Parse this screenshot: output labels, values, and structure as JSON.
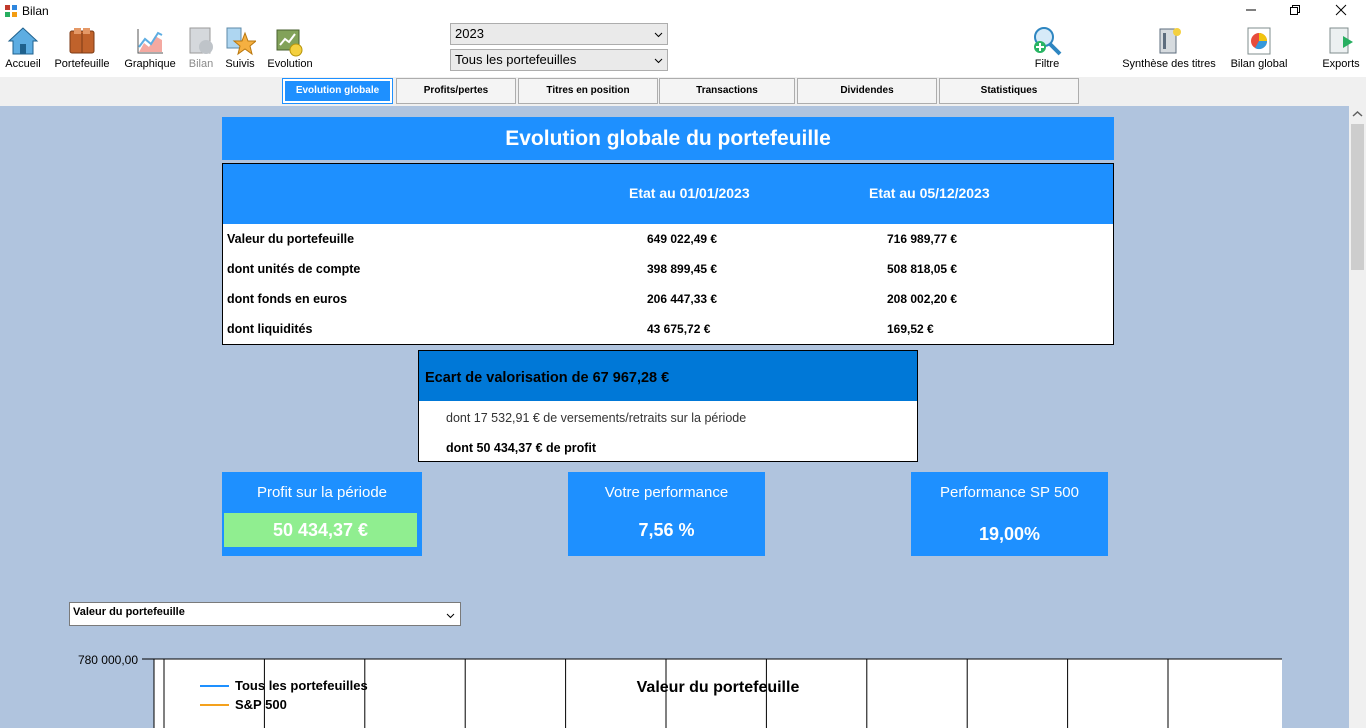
{
  "window": {
    "title": "Bilan"
  },
  "toolbar": {
    "items": [
      {
        "label": "Accueil",
        "icon": "home-icon"
      },
      {
        "label": "Portefeuille",
        "icon": "portfolio-icon"
      },
      {
        "label": "Graphique",
        "icon": "chart-icon"
      },
      {
        "label": "Bilan",
        "icon": "report-icon",
        "disabled": true
      },
      {
        "label": "Suivis",
        "icon": "star-icon"
      },
      {
        "label": "Evolution",
        "icon": "evolution-icon"
      },
      {
        "label": "Filtre",
        "icon": "search-filter-icon"
      },
      {
        "label": "Synthèse des titres",
        "icon": "summary-icon"
      },
      {
        "label": "Bilan global",
        "icon": "global-report-icon"
      },
      {
        "label": "Exports",
        "icon": "export-icon"
      }
    ],
    "year_select": "2023",
    "portfolio_select": "Tous les portefeuilles"
  },
  "tabs": [
    {
      "label": "Evolution globale",
      "active": true
    },
    {
      "label": "Profits/pertes"
    },
    {
      "label": "Titres en position"
    },
    {
      "label": "Transactions"
    },
    {
      "label": "Dividendes"
    },
    {
      "label": "Statistiques"
    }
  ],
  "evolution": {
    "title": "Evolution globale du portefeuille",
    "col1": "Etat au 01/01/2023",
    "col2": "Etat au 05/12/2023",
    "rows": [
      {
        "label": "Valeur du portefeuille",
        "v1": "649 022,49 €",
        "v2": "716 989,77 €"
      },
      {
        "label": "dont unités de compte",
        "v1": "398 899,45 €",
        "v2": "508 818,05 €"
      },
      {
        "label": "dont fonds en euros",
        "v1": "206 447,33 €",
        "v2": "208 002,20 €"
      },
      {
        "label": "dont liquidités",
        "v1": "43 675,72 €",
        "v2": "169,52 €"
      }
    ]
  },
  "ecart": {
    "title": "Ecart de valorisation de 67 967,28 €",
    "line1": "dont 17 532,91 € de versements/retraits sur la période",
    "line2": "dont 50 434,37 € de profit"
  },
  "kpis": {
    "profit_title": "Profit sur la période",
    "profit_value": "50 434,37 €",
    "perf_title": "Votre performance",
    "perf_value": "7,56 %",
    "sp_title": "Performance SP 500",
    "sp_value": "19,00%"
  },
  "chart_selector": "Valeur du portefeuille",
  "chart_data": {
    "type": "line",
    "title": "Valeur du portefeuille",
    "y_tick_labels": [
      "780 000,00"
    ],
    "series": [
      {
        "name": "Tous les portefeuilles",
        "color": "#1e90ff",
        "values": []
      },
      {
        "name": "S&P 500",
        "color": "#f4a11d",
        "values": []
      }
    ],
    "grid": true,
    "legend": "top-left"
  },
  "colors": {
    "accent": "#1e90ff",
    "ecart_header": "#0078d7",
    "profit_box": "#90ee90",
    "content_bg": "#b0c4de"
  }
}
